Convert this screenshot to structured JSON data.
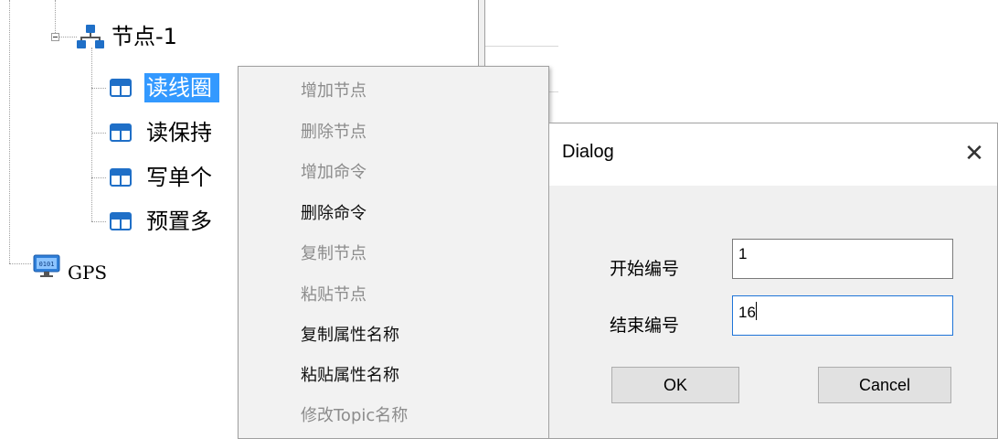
{
  "tree": {
    "node": {
      "label": "节点-1",
      "icon": "network-nodes-icon"
    },
    "items": [
      {
        "label": "读线圈",
        "icon": "window-icon",
        "selected": true
      },
      {
        "label": "读保持",
        "icon": "window-icon",
        "selected": false
      },
      {
        "label": "写单个",
        "icon": "window-icon",
        "selected": false
      },
      {
        "label": "预置多",
        "icon": "window-icon",
        "selected": false
      }
    ],
    "gps": {
      "label": "GPS",
      "icon": "monitor-icon"
    }
  },
  "context_menu": {
    "items": [
      {
        "label": "增加节点",
        "enabled": false
      },
      {
        "label": "删除节点",
        "enabled": false
      },
      {
        "label": "增加命令",
        "enabled": false
      },
      {
        "label": "删除命令",
        "enabled": true
      },
      {
        "label": "复制节点",
        "enabled": false
      },
      {
        "label": "粘贴节点",
        "enabled": false
      },
      {
        "label": "复制属性名称",
        "enabled": true
      },
      {
        "label": "粘贴属性名称",
        "enabled": true
      },
      {
        "label": "修改Topic名称",
        "enabled": false
      }
    ]
  },
  "dialog": {
    "title": "Dialog",
    "close_icon": "close-icon",
    "fields": {
      "start_label": "开始编号",
      "start_value": "1",
      "end_label": "结束编号",
      "end_value": "16"
    },
    "buttons": {
      "ok": "OK",
      "cancel": "Cancel"
    }
  },
  "colors": {
    "selection": "#3399ff",
    "icon_blue": "#1f6fc7",
    "focus_border": "#1e74d8",
    "menu_bg": "#f2f2f2",
    "disabled_text": "#8c8c8c"
  }
}
